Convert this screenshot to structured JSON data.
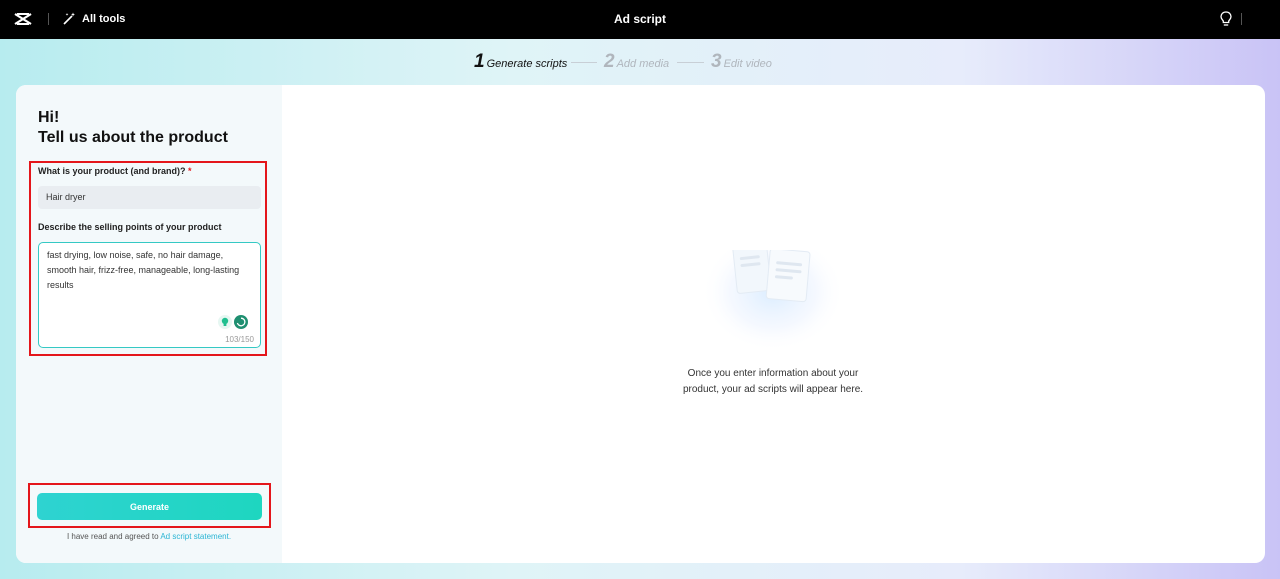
{
  "topbar": {
    "all_tools_label": "All tools",
    "title": "Ad script"
  },
  "steps": [
    {
      "num": "1",
      "label": "Generate scripts",
      "state": "active"
    },
    {
      "num": "2",
      "label": "Add media",
      "state": "inactive"
    },
    {
      "num": "3",
      "label": "Edit video",
      "state": "inactive"
    }
  ],
  "form": {
    "greeting": "Hi!",
    "heading": "Tell us about the product",
    "product_label": "What is your product (and brand)?",
    "required_mark": "*",
    "product_value": "Hair dryer",
    "selling_label": "Describe the selling points of your product",
    "selling_value": "fast drying, low noise, safe, no hair damage, smooth hair, frizz-free, manageable, long-lasting results",
    "char_count": "103/150",
    "generate_label": "Generate",
    "agree_text": "I have read and agreed to ",
    "agree_link": "Ad script statement."
  },
  "main": {
    "empty_line1": "Once you enter information about your",
    "empty_line2": "product, your ad scripts will appear here."
  },
  "colors": {
    "accent": "#1ed6c0",
    "highlight_border": "#e4161b",
    "link": "#2bb5d4"
  }
}
